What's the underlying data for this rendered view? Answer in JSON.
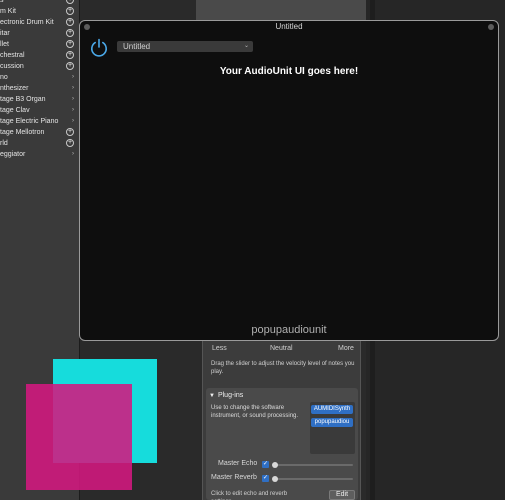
{
  "library": {
    "items": [
      {
        "label": "s",
        "action": "plus"
      },
      {
        "label": "m Kit",
        "action": "plus"
      },
      {
        "label": "ectronic Drum Kit",
        "action": "plus"
      },
      {
        "label": "itar",
        "action": "plus"
      },
      {
        "label": "llet",
        "action": "plus"
      },
      {
        "label": "chestral",
        "action": "plus"
      },
      {
        "label": "cussion",
        "action": "plus"
      },
      {
        "label": "no",
        "action": "chevron"
      },
      {
        "label": "nthesizer",
        "action": "chevron"
      },
      {
        "label": "tage B3 Organ",
        "action": "chevron"
      },
      {
        "label": "tage Clav",
        "action": "chevron"
      },
      {
        "label": "tage Electric Piano",
        "action": "chevron"
      },
      {
        "label": "tage Mellotron",
        "action": "plus"
      },
      {
        "label": "rld",
        "action": "plus"
      },
      {
        "label": "eggiator",
        "action": "chevron"
      }
    ]
  },
  "au_window": {
    "title": "Untitled",
    "preset": "Untitled",
    "heading": "Your AudioUnit UI goes here!",
    "footer": "popupaudiounit",
    "accent": "#4aa8e8"
  },
  "inspector": {
    "velocity": {
      "less": "Less",
      "neutral": "Neutral",
      "more": "More"
    },
    "velocity_desc": "Drag the slider to adjust the velocity level of notes you play.",
    "plugins_title": "Plug-ins",
    "plugins_desc": "Use to change the software instrument, or sound processing.",
    "slots": [
      "AUMIDISynth",
      "popupaudiou"
    ],
    "master_echo": "Master Echo",
    "master_reverb": "Master Reverb",
    "edit_desc": "Click to edit echo and reverb settings.",
    "edit_label": "Edit"
  },
  "colors": {
    "cyan": "#16dcdc",
    "magenta": "#d41880",
    "button_blue": "#2f6fc4"
  }
}
